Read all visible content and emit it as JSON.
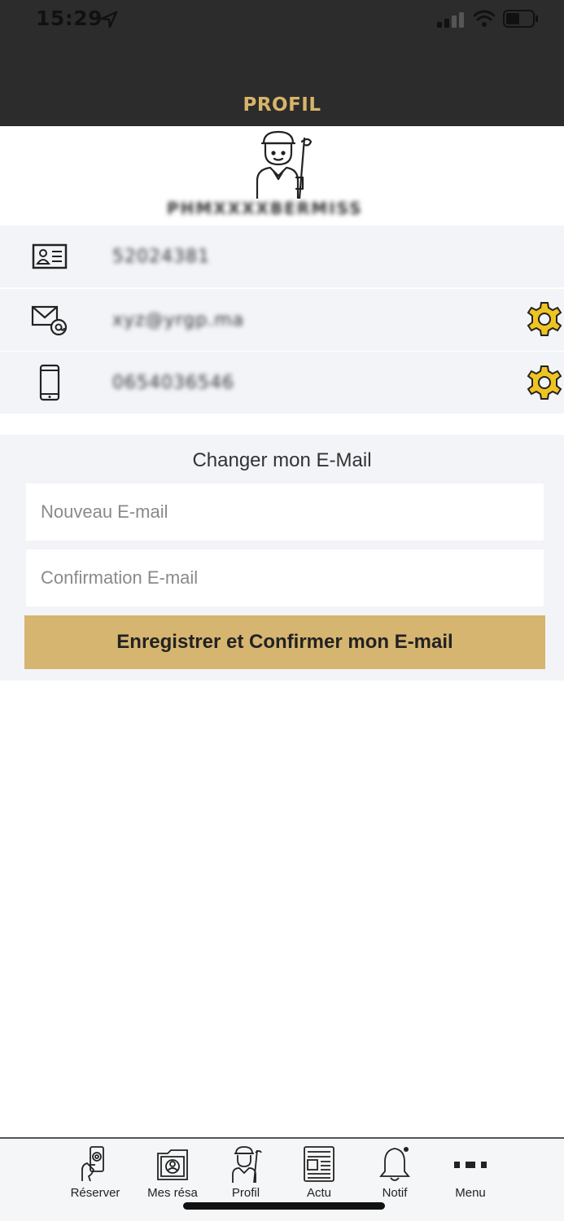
{
  "status_bar": {
    "time": "15:29"
  },
  "header": {
    "title": "PROFIL"
  },
  "profile": {
    "name": "PHMXXXXBERMISS",
    "member_id": "52024381",
    "email": "xyz@yrgp.ma",
    "phone": "0654036546"
  },
  "change_email": {
    "title": "Changer mon E-Mail",
    "new_email_placeholder": "Nouveau E-mail",
    "confirm_email_placeholder": "Confirmation E-mail",
    "submit_label": "Enregistrer et Confirmer mon E-mail"
  },
  "tabs": [
    {
      "label": "Réserver",
      "icon": "reserve-icon"
    },
    {
      "label": "Mes résa",
      "icon": "bookings-icon"
    },
    {
      "label": "Profil",
      "icon": "golfer-icon"
    },
    {
      "label": "Actu",
      "icon": "news-icon"
    },
    {
      "label": "Notif",
      "icon": "bell-icon"
    },
    {
      "label": "Menu",
      "icon": "more-icon"
    }
  ],
  "colors": {
    "accent": "#d8b46a",
    "button": "#d6b571",
    "gear": "#f0c420",
    "header_bg": "#2c2c2c",
    "row_bg": "#f3f4f8"
  }
}
